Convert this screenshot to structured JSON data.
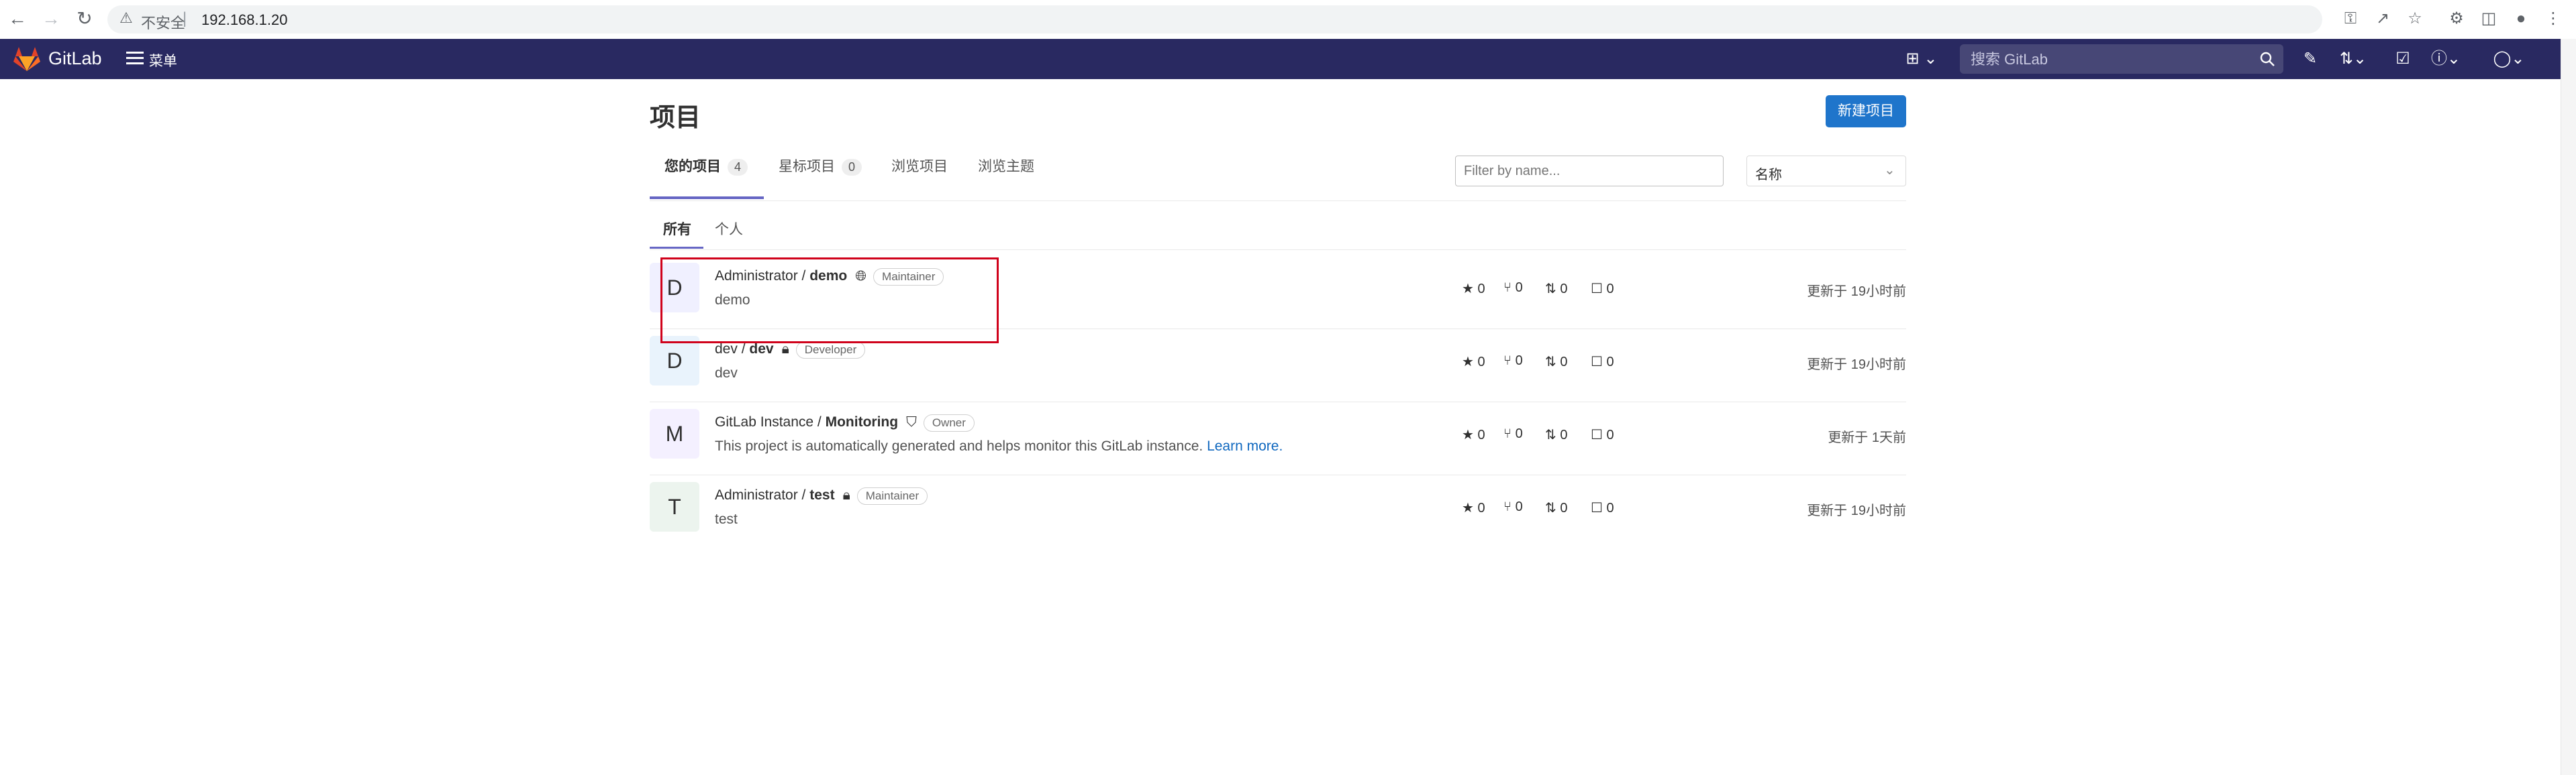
{
  "browser": {
    "insecure_label": "不安全",
    "url": "192.168.1.20"
  },
  "header": {
    "brand": "GitLab",
    "menu_label": "菜单",
    "search_placeholder": "搜索 GitLab"
  },
  "page": {
    "title": "项目",
    "new_project_label": "新建项目",
    "tabs": [
      {
        "label": "您的项目",
        "count": "4"
      },
      {
        "label": "星标项目",
        "count": "0"
      },
      {
        "label": "浏览项目"
      },
      {
        "label": "浏览主题"
      }
    ],
    "filter_placeholder": "Filter by name...",
    "sort_selected": "名称",
    "subtabs": [
      "所有",
      "个人"
    ]
  },
  "projects": [
    {
      "avatar_letter": "D",
      "avatar_color": "#f0f0ff",
      "namespace": "Administrator / ",
      "name": "demo",
      "visibility_icon": "globe-icon",
      "role": "Maintainer",
      "description": "demo",
      "stars": "0",
      "forks": "0",
      "mrs": "0",
      "issues": "0",
      "updated": "更新于 19小时前"
    },
    {
      "avatar_letter": "D",
      "avatar_color": "#e9f3fc",
      "namespace": "dev / ",
      "name": "dev",
      "visibility_icon": "lock-icon",
      "role": "Developer",
      "description": "dev",
      "stars": "0",
      "forks": "0",
      "mrs": "0",
      "issues": "0",
      "updated": "更新于 19小时前"
    },
    {
      "avatar_letter": "M",
      "avatar_color": "#f4f0ff",
      "namespace": "GitLab Instance / ",
      "name": "Monitoring",
      "visibility_icon": "shield-icon",
      "role": "Owner",
      "description": "This project is automatically generated and helps monitor this GitLab instance.",
      "learn_more": "Learn more.",
      "stars": "0",
      "forks": "0",
      "mrs": "0",
      "issues": "0",
      "updated": "更新于 1天前"
    },
    {
      "avatar_letter": "T",
      "avatar_color": "#ecf4ee",
      "namespace": "Administrator / ",
      "name": "test",
      "visibility_icon": "lock-icon",
      "role": "Maintainer",
      "description": "test",
      "stars": "0",
      "forks": "0",
      "mrs": "0",
      "issues": "0",
      "updated": "更新于 19小时前"
    }
  ],
  "highlight_color": "#d0021b"
}
